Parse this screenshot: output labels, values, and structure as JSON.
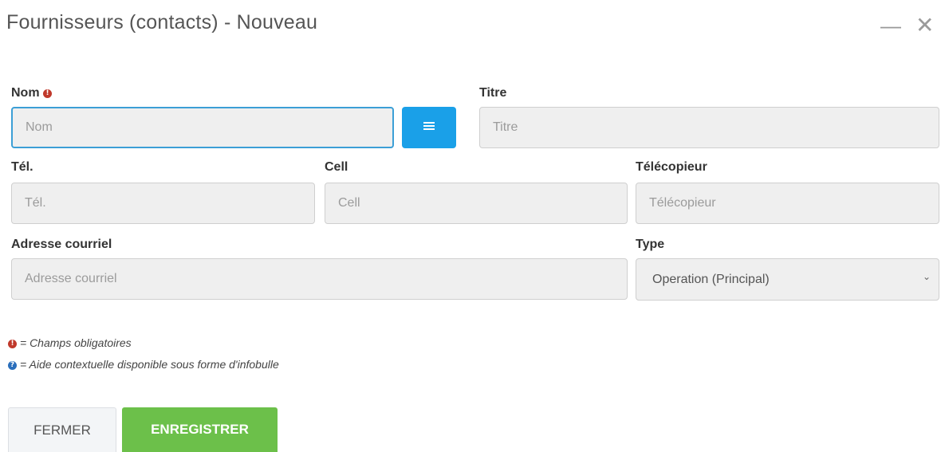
{
  "dialog": {
    "title": "Fournisseurs (contacts) - Nouveau",
    "minimize_label": "—",
    "close_label": "✕"
  },
  "form": {
    "nom": {
      "label": "Nom",
      "placeholder": "Nom",
      "value": "",
      "required": true
    },
    "titre": {
      "label": "Titre",
      "placeholder": "Titre",
      "value": ""
    },
    "tel": {
      "label": "Tél.",
      "placeholder": "Tél.",
      "value": ""
    },
    "cell": {
      "label": "Cell",
      "placeholder": "Cell",
      "value": ""
    },
    "telecopieur": {
      "label": "Télécopieur",
      "placeholder": "Télécopieur",
      "value": ""
    },
    "courriel": {
      "label": "Adresse courriel",
      "placeholder": "Adresse courriel",
      "value": ""
    },
    "type": {
      "label": "Type",
      "selected": "Operation (Principal)"
    }
  },
  "legend": {
    "required_text": "= Champs obligatoires",
    "help_text": "= Aide contextuelle disponible sous forme d'infobulle",
    "required_glyph": "!",
    "help_glyph": "?"
  },
  "buttons": {
    "close_label": "FERMER",
    "save_label": "ENREGISTRER"
  },
  "colors": {
    "required_icon": "#c0392b",
    "help_icon": "#2a6ebb",
    "picker_button": "#1aa0e8",
    "save_button": "#6cc04a",
    "focus_border": "#3c9fd6"
  },
  "icons": {
    "picker": "list-icon",
    "select": "chevron-down-icon",
    "minimize": "minimize-icon",
    "close": "close-icon"
  }
}
